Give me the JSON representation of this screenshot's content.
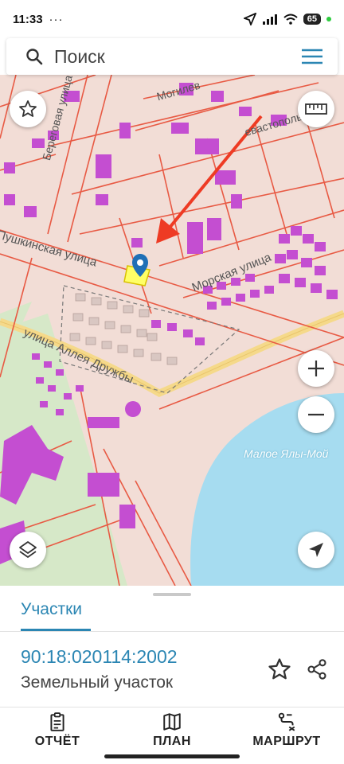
{
  "status_bar": {
    "time": "11:33",
    "dots": "···",
    "battery": "65"
  },
  "search": {
    "placeholder": "Поиск"
  },
  "map": {
    "streets": [
      "Береговая улица",
      "Морская улица",
      "Пушкинская улица",
      "улица Аллея Дружбы",
      "Могилев",
      "евастополь"
    ],
    "lake_name": "Малое Ялы-Мой",
    "colors": {
      "land": "#f2ddd6",
      "building": "#c44ed1",
      "parcel_line": "#e85a44",
      "road": "#f5d98a",
      "water": "#a6dcf0",
      "green": "#d6e8c8",
      "selected": "#ffff66"
    }
  },
  "controls": [
    "star-icon",
    "ruler-icon",
    "plus-icon",
    "minus-icon",
    "layers-icon",
    "navigation-icon"
  ],
  "sheet": {
    "tab_label": "Участки",
    "parcel_id": "90:18:020114:2002",
    "parcel_type": "Земельный участок"
  },
  "bottom_nav": {
    "report": "ОТЧЁТ",
    "plan": "ПЛАН",
    "route": "МАРШРУТ"
  }
}
